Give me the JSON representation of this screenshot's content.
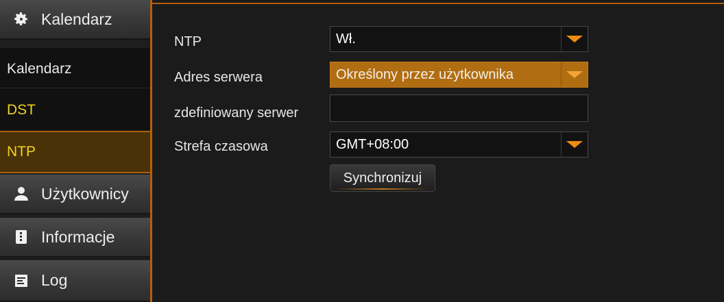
{
  "sidebar": {
    "categories": [
      {
        "label": "Kalendarz",
        "icon": "gear-icon"
      },
      {
        "label": "Użytkownicy",
        "icon": "user-icon"
      },
      {
        "label": "Informacje",
        "icon": "info-device-icon"
      },
      {
        "label": "Log",
        "icon": "log-icon"
      }
    ],
    "subitems": [
      {
        "label": "Kalendarz"
      },
      {
        "label": "DST"
      },
      {
        "label": "NTP"
      }
    ]
  },
  "form": {
    "ntp": {
      "label": "NTP",
      "value": "Wł."
    },
    "server_address": {
      "label": "Adres serwera",
      "value": "Określony przez użytkownika"
    },
    "custom_server": {
      "label": "zdefiniowany serwer",
      "value": ""
    },
    "timezone": {
      "label": "Strefa czasowa",
      "value": "GMT+08:00"
    },
    "sync_button": "Synchronizuj"
  },
  "colors": {
    "accent": "#b4600e",
    "active_text": "#f0d21e",
    "dropdown_arrow": "#f08c14",
    "highlight_field": "#b06d12"
  }
}
